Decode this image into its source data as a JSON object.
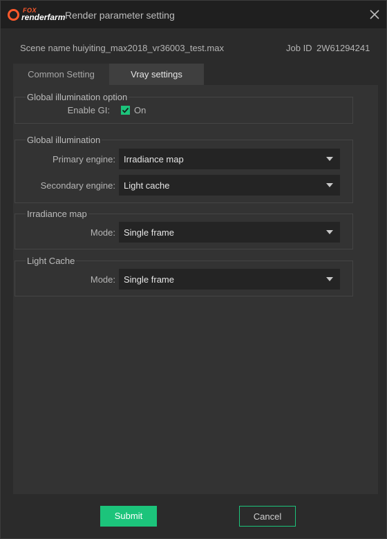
{
  "window": {
    "logo": {
      "top": "FOX",
      "bottom": "renderfarm"
    },
    "title": "Render parameter setting"
  },
  "scene": {
    "name_label": "Scene name",
    "name_value": "huiyiting_max2018_vr36003_test.max",
    "job_label": "Job ID",
    "job_value": "2W61294241"
  },
  "tabs": [
    {
      "label": "Common Setting",
      "active": false
    },
    {
      "label": "Vray settings",
      "active": true
    }
  ],
  "groups": {
    "gi_option": {
      "title": "Global illumination option",
      "enable_label": "Enable GI:",
      "enable_checked": true,
      "enable_text": "On"
    },
    "gi": {
      "title": "Global illumination",
      "primary_label": "Primary engine:",
      "primary_value": "Irradiance map",
      "secondary_label": "Secondary engine:",
      "secondary_value": "Light cache"
    },
    "irradiance": {
      "title": "Irradiance map",
      "mode_label": "Mode:",
      "mode_value": "Single frame"
    },
    "light_cache": {
      "title": "Light Cache",
      "mode_label": "Mode:",
      "mode_value": "Single frame"
    }
  },
  "buttons": {
    "submit": "Submit",
    "cancel": "Cancel"
  },
  "colors": {
    "accent": "#1cc47b",
    "logo": "#ff5a2c"
  }
}
